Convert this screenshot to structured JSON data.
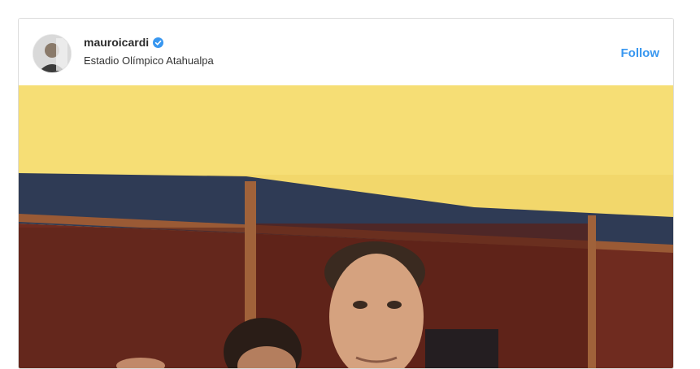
{
  "post": {
    "username": "mauroicardi",
    "location": "Estadio Olímpico Atahualpa",
    "follow_label": "Follow",
    "verified": true
  },
  "icons": {
    "verified": "verified-badge-icon"
  },
  "colors": {
    "follow": "#3897f0",
    "verified": "#3897f0",
    "wall": "#f4d96a",
    "lockers": "#7a2a1c"
  }
}
